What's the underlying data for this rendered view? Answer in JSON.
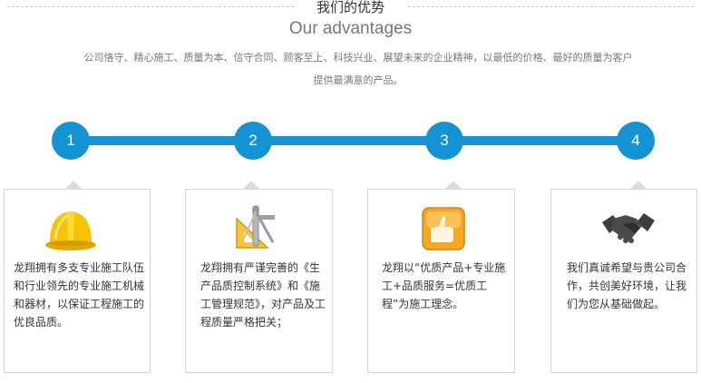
{
  "header": {
    "title_cn": "我们的优势",
    "title_en": "Our advantages",
    "intro": "公司恪守、精心施工、质量为本、信守合同、顾客至上、科技兴业、展望未来的企业精神，以最低的价格、最好的质量为客户提供最满意的产品。"
  },
  "steps": [
    "1",
    "2",
    "3",
    "4"
  ],
  "cards": [
    {
      "icon": "hard-hat-icon",
      "text": "龙翔拥有多支专业施工队伍和行业领先的专业施工机械和器材，以保证工程施工的优良品质。"
    },
    {
      "icon": "drafting-tools-icon",
      "text": "龙翔拥有严谨完善的《生产品质控制系统》和《施工管理规范》，对产品及工程质量严格把关；"
    },
    {
      "icon": "thumbs-up-icon",
      "text": "龙翔以“优质产品+专业施工+品质服务=优质工程”为施工理念。"
    },
    {
      "icon": "handshake-icon",
      "text": "我们真诚希望与贵公司合作，共创美好环境，让我们为您从基础做起。"
    }
  ],
  "colors": {
    "accent": "#1592d2",
    "border": "#d4d4d4",
    "muted_text": "#777777"
  }
}
